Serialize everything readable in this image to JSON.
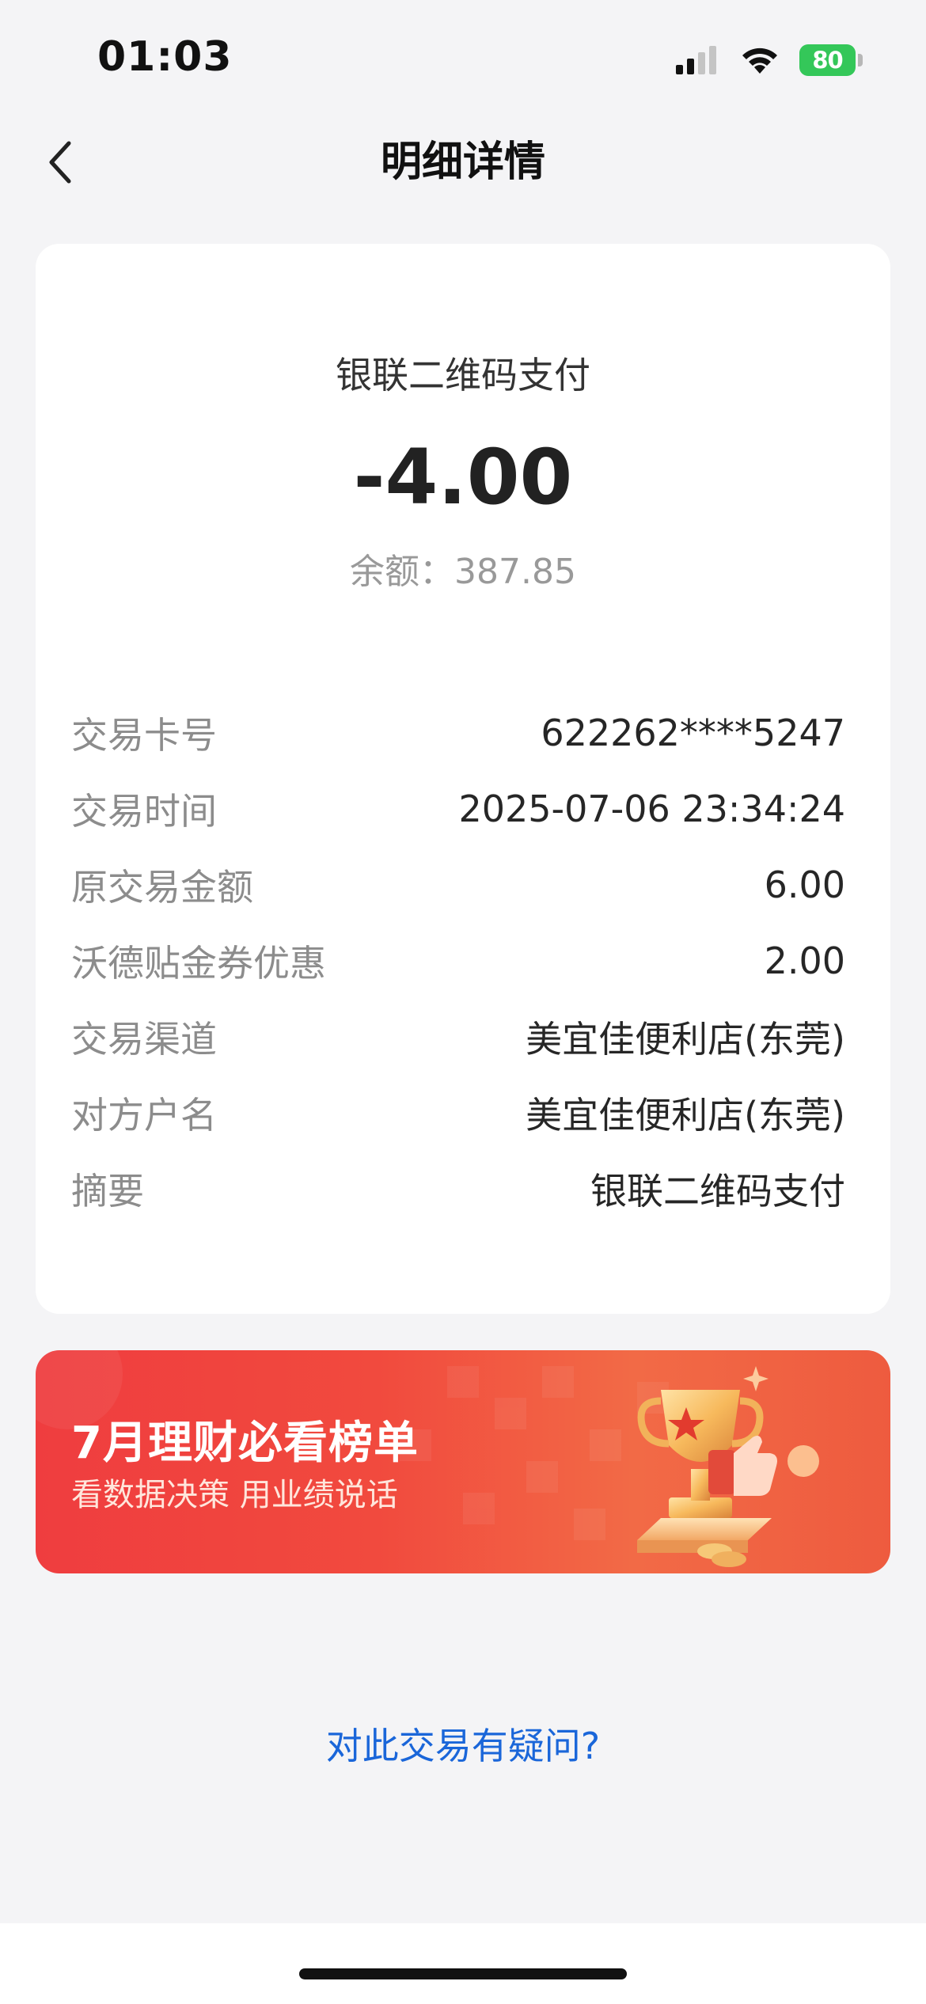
{
  "status_bar": {
    "time": "01:03",
    "battery": "80"
  },
  "nav": {
    "title": "明细详情"
  },
  "transaction": {
    "type": "银联二维码支付",
    "amount": "-4.00",
    "balance": "余额：387.85"
  },
  "details": [
    {
      "label": "交易卡号",
      "value": "622262****5247"
    },
    {
      "label": "交易时间",
      "value": "2025-07-06 23:34:24"
    },
    {
      "label": "原交易金额",
      "value": "6.00"
    },
    {
      "label": "沃德贴金券优惠",
      "value": "2.00"
    },
    {
      "label": "交易渠道",
      "value": "美宜佳便利店(东莞)"
    },
    {
      "label": "对方户名",
      "value": "美宜佳便利店(东莞)"
    },
    {
      "label": "摘要",
      "value": "银联二维码支付"
    }
  ],
  "banner": {
    "title": "7月理财必看榜单",
    "subtitle": "看数据决策 用业绩说话"
  },
  "question_link": "对此交易有疑问?",
  "colors": {
    "link": "#1a66d9",
    "battery": "#34c759",
    "banner_red": "#ef3d3f"
  }
}
